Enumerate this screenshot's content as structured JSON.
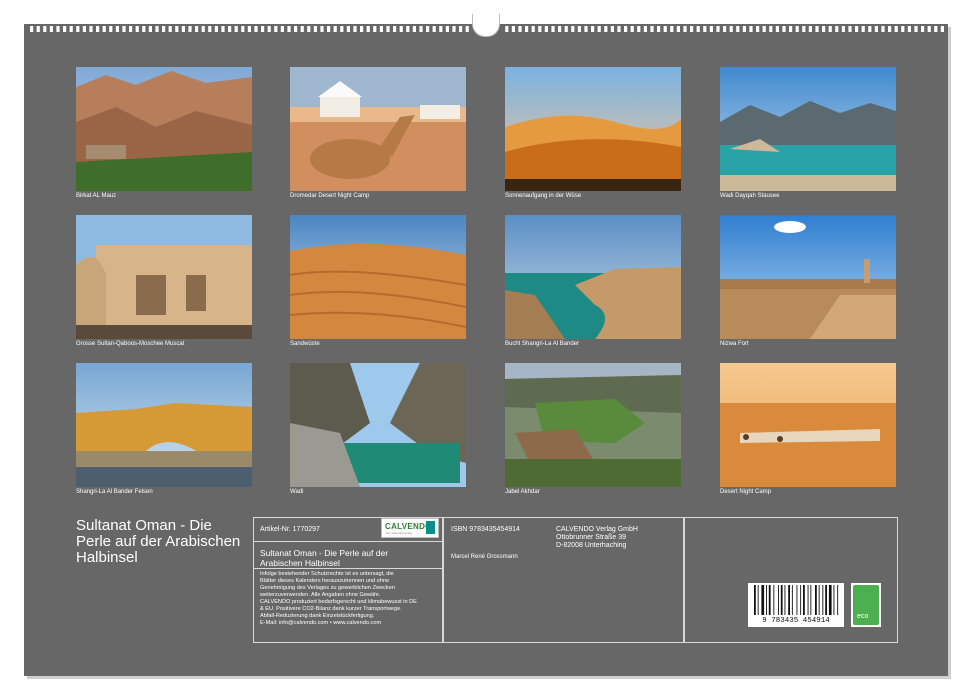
{
  "photos": [
    {
      "caption": "Birkat AL Mauz"
    },
    {
      "caption": "Dromedar Desert Night Camp"
    },
    {
      "caption": "Sonnenaufgang in der Wüse"
    },
    {
      "caption": "Wadi Dayqah Stausee"
    },
    {
      "caption": "Grosse Sultan-Qaboos-Moschee Muscat"
    },
    {
      "caption": "Sandwüste"
    },
    {
      "caption": "Bucht Shangri-La Al Bander"
    },
    {
      "caption": "Nizwa Fort"
    },
    {
      "caption": "Shangri-La Al Bander Felsen"
    },
    {
      "caption": "Wadi"
    },
    {
      "caption": "Jabel Akhdar"
    },
    {
      "caption": "Desert Night Camp"
    }
  ],
  "calendar": {
    "title": "Sultanat Oman - Die Perle auf der Arabischen Halbinsel",
    "article_no": "Artikel-Nr. 1770297",
    "product_title": "Sultanat Oman - Die Perle auf der Arabischen Halbinsel",
    "legal_text": [
      "Infolge bestehender Schutzrechte ist es untersagt, die",
      "Blätter dieses Kalenders herauszutrennen und ohne",
      "Genehmigung des Verlages zu gewerblichen Zwecken",
      "weiterzuverwenden. Alle Angaben ohne Gewähr.",
      "CALVENDO produziert bedarfsgerecht und klimabewusst in DE",
      "& EU. Positivere CO2-Bilanz dank kurzer Transportwege.",
      "Abfall-Reduzierung dank Einzelstückfertigung.",
      "E-Mail: info@calvendo.com • www.calvendo.com"
    ],
    "isbn": "ISBN 9783435454914",
    "author": "Marcel René Grossmann",
    "publisher_lines": [
      "CALVENDO Verlag GmbH",
      "Ottobrunner Straße 39",
      "D-82008 Unterhaching"
    ],
    "logo_text": "CALVENDO",
    "logo_sub": "Der Kalenderverlag",
    "barcode_number": "9 783435 454914",
    "eco_label": "eco"
  },
  "colors": {
    "background": "#676767",
    "text": "#ffffff"
  }
}
